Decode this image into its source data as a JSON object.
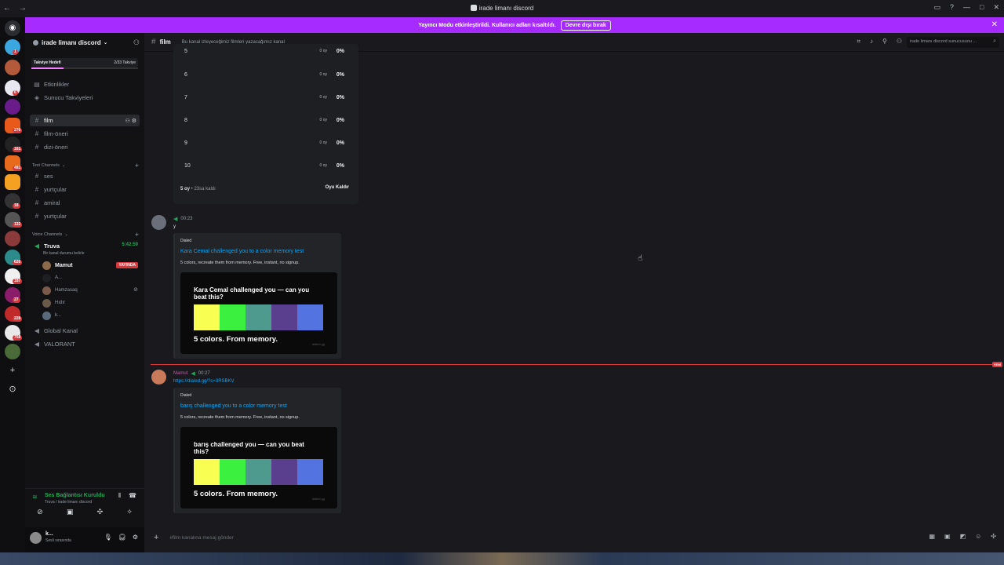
{
  "window": {
    "title": "irade limanı discord"
  },
  "notice": {
    "text": "Yayıncı Modu etkinleştirildi. Kullanıcı adları kısaltıldı.",
    "button": "Devre dışı bırak"
  },
  "rail_badges": [
    "1",
    "",
    "",
    "6",
    "",
    "276",
    "161",
    "481",
    "",
    "18",
    "122",
    "626",
    "187",
    "27",
    "228",
    "768",
    "4"
  ],
  "guild": {
    "name": "irade limanı discord",
    "boost_goal": "Takviye Hedefi",
    "boost_count": "2/33 Takviye"
  },
  "sidebar": {
    "events": "Etkinlikler",
    "boosts": "Sunucu Takviyeleri",
    "channels": [
      "film",
      "film-öneri",
      "dizi-öneri"
    ],
    "text_category": "Text Channels",
    "text_channels": [
      "ses",
      "yurtçular",
      "amiral",
      "yurtçular"
    ],
    "voice_category": "Voice Channels",
    "voice_channel": "Truva",
    "voice_timer": "5:42:59",
    "voice_status": "Bir kanal durumu belirle",
    "voice_users": [
      "Mamut",
      "A...",
      "Hamzasaq",
      "Hıdır",
      "k..."
    ],
    "live_label": "YAYINDA",
    "global": "Global Kanal",
    "valorant": "VALORANT"
  },
  "voice_panel": {
    "status": "Ses Bağlantısı Kuruldu",
    "sub": "Truva / irade limanı discord"
  },
  "user": {
    "name": "k...",
    "status": "Sesli sırasında"
  },
  "header": {
    "channel": "film",
    "topic": "Bu kanal izleyeceğimiz filmleri yazacağımız kanal",
    "search_placeholder": "irade limanı discord sunucusunu ..."
  },
  "poll": {
    "rows": [
      {
        "label": "5",
        "votes": "0 oy",
        "pct": "0%"
      },
      {
        "label": "6",
        "votes": "0 oy",
        "pct": "0%"
      },
      {
        "label": "7",
        "votes": "0 oy",
        "pct": "0%"
      },
      {
        "label": "8",
        "votes": "0 oy",
        "pct": "0%"
      },
      {
        "label": "9",
        "votes": "0 oy",
        "pct": "0%"
      },
      {
        "label": "10",
        "votes": "0 oy",
        "pct": "0%"
      }
    ],
    "total": "5 oy",
    "time_left": "23sa kaldı",
    "remove": "Oyu Kaldır"
  },
  "messages": [
    {
      "time": "00:23",
      "text": "y",
      "embed": {
        "provider": "Dialed",
        "title": "Kara Cemal challenged you to a color memory test",
        "desc": "5 colors, recreate them from memory. Free, instant, no signup.",
        "img_head": "Kara Cemal challenged you — can you beat this?",
        "img_tag": "5 colors. From memory.",
        "brand": "dialed.gg"
      }
    },
    {
      "author": "Mamut",
      "time": "00:27",
      "text": "https://dialed.gg/?c=3RSBKV",
      "embed": {
        "provider": "Dialed",
        "title": "barış challenged you to a color memory test",
        "desc": "5 colors, recreate them from memory. Free, instant, no signup.",
        "img_head": "barış challenged you — can you beat this?",
        "img_tag": "5 colors. From memory.",
        "brand": "dialed.gg"
      }
    }
  ],
  "swatches": [
    "#f9ff52",
    "#3cf040",
    "#4f9a8e",
    "#5a3f8e",
    "#5273e0"
  ],
  "new_tag": "YENİ",
  "composer": {
    "placeholder": "#film kanalına mesaj gönder"
  }
}
